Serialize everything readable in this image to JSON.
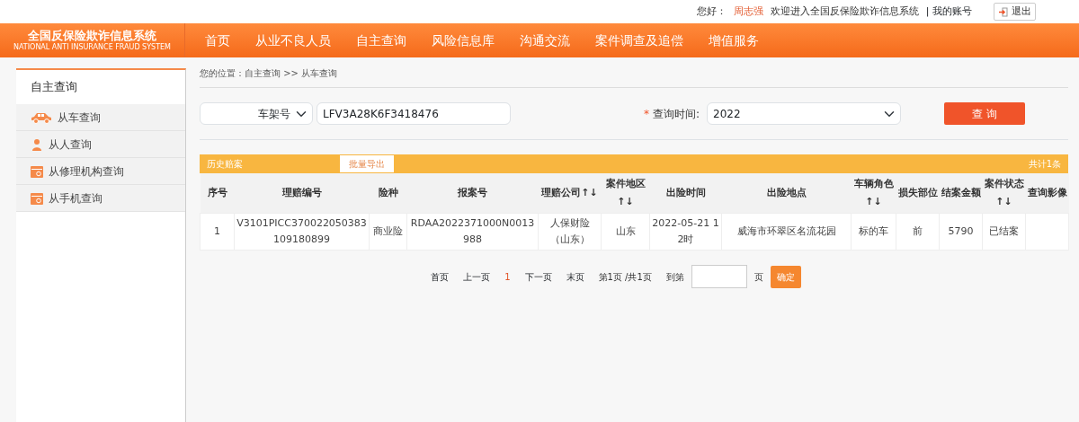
{
  "topbar": {
    "greeting": "您好：",
    "user": "周志强",
    "welcome": "欢迎进入全国反保险欺诈信息系统",
    "account": "| 我的账号",
    "logout": "退出"
  },
  "logo": {
    "title": "全国反保险欺诈信息系统",
    "subtitle": "NATIONAL ANTI INSURANCE FRAUD SYSTEM"
  },
  "nav": [
    {
      "label": "首页"
    },
    {
      "label": "从业不良人员"
    },
    {
      "label": "自主查询"
    },
    {
      "label": "风险信息库"
    },
    {
      "label": "沟通交流"
    },
    {
      "label": "案件调查及追偿"
    },
    {
      "label": "增值服务"
    }
  ],
  "sidebar": {
    "title": "自主查询",
    "items": [
      {
        "label": "从车查询",
        "kind": "car"
      },
      {
        "label": "从人查询",
        "kind": "person"
      },
      {
        "label": "从修理机构查询",
        "kind": "calendar"
      },
      {
        "label": "从手机查询",
        "kind": "calendar"
      }
    ]
  },
  "breadcrumb": "您的位置：自主查询 >> 从车查询",
  "search": {
    "type_select": "车架号",
    "value": "LFV3A28K6F3418476",
    "required_mark": "*",
    "time_label": "查询时间:",
    "time_select": "2022",
    "button": "查 询"
  },
  "results": {
    "title": "历史赔案",
    "export": "批量导出",
    "total": "共计1条",
    "columns": [
      "序号",
      "理赔编号",
      "险种",
      "报案号",
      "理赔公司↑↓",
      "案件地区↑↓",
      "出险时间",
      "出险地点",
      "车辆角色↑↓",
      "损失部位",
      "结案金额",
      "案件状态↑↓",
      "查询影像"
    ],
    "rows": [
      [
        "1",
        "V3101PICC370022050383109180899",
        "商业险",
        "RDAA2022371000N0013988",
        "人保财险（山东）",
        "山东",
        "2022-05-21 12时",
        "威海市环翠区名流花园",
        "标的车",
        "前",
        "5790",
        "已结案",
        null
      ]
    ]
  },
  "pagination": {
    "first": "首页",
    "prev": "上一页",
    "current": "1",
    "next": "下一页",
    "last": "末页",
    "info": "第1页 /共1页",
    "goto": "到第",
    "unit": "页",
    "confirm": "确定"
  }
}
